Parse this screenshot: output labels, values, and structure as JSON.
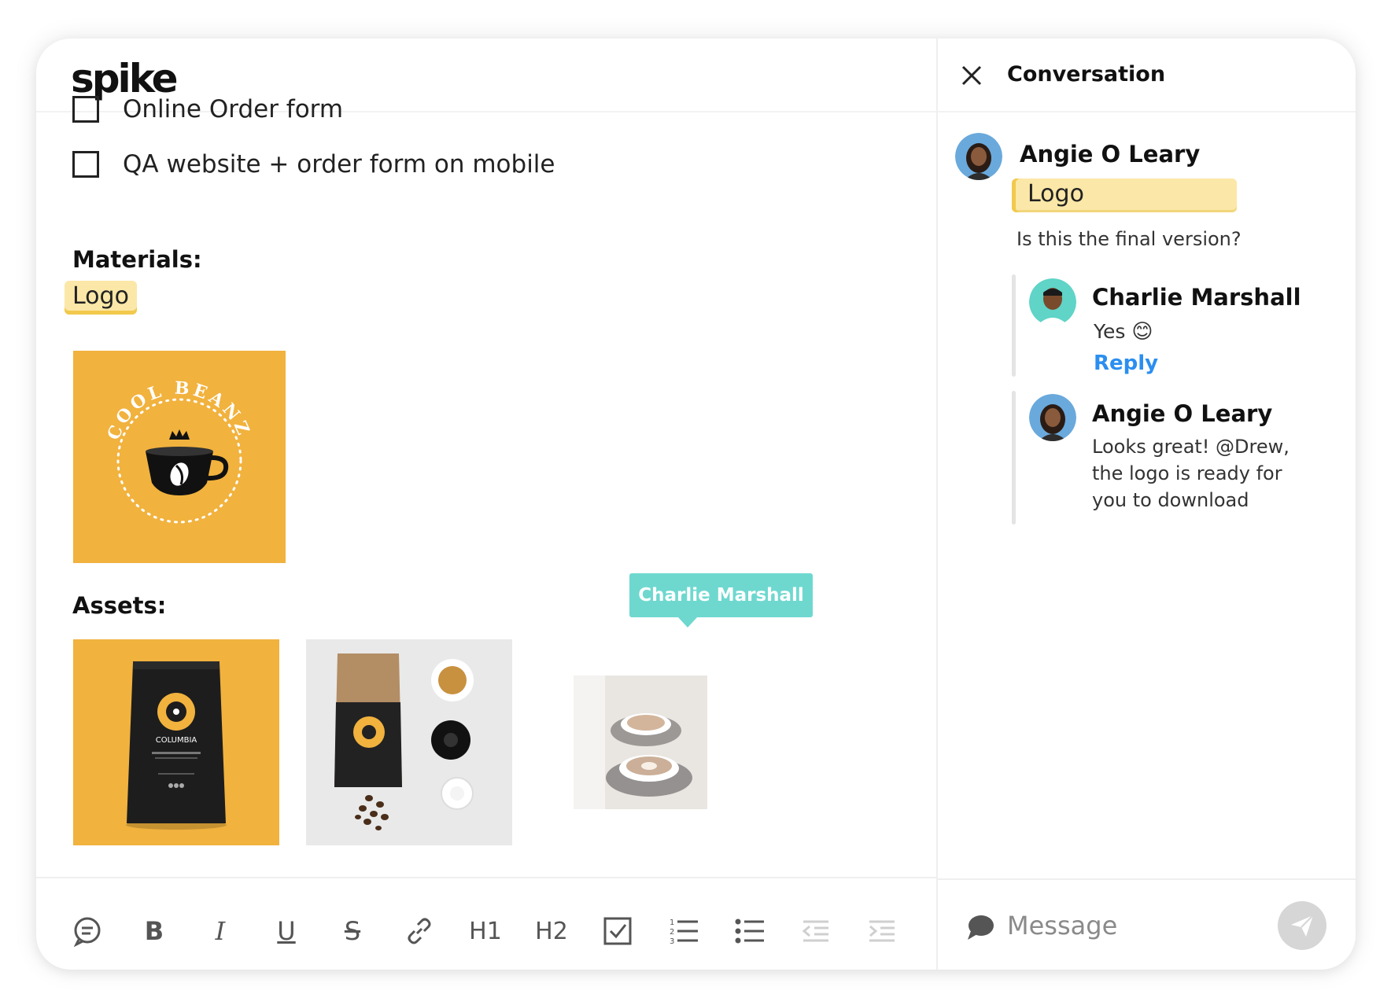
{
  "app": {
    "logo_text": "spike"
  },
  "editor": {
    "tasks": [
      {
        "label": "Online Order form",
        "checked": false
      },
      {
        "label": "QA website + order form on mobile",
        "checked": false
      }
    ],
    "materials_heading": "Materials:",
    "materials_tag": "Logo",
    "logo_image": {
      "ring_text": "COOL BEANZ",
      "icon": "coffee-cup-with-crown",
      "bg_color": "#f1b23e"
    },
    "assets_heading": "Assets:",
    "assets": [
      {
        "name": "coffee-bag-photo",
        "label_text": "COLUMBIA"
      },
      {
        "name": "coffee-flatlay-photo"
      },
      {
        "name": "latte-cups-photo"
      }
    ],
    "cursor_tooltip": "Charlie Marshall"
  },
  "toolbar": {
    "items": [
      {
        "name": "comment-icon"
      },
      {
        "name": "bold-icon",
        "glyph": "B"
      },
      {
        "name": "italic-icon",
        "glyph": "I"
      },
      {
        "name": "underline-icon",
        "glyph": "U"
      },
      {
        "name": "strikethrough-icon",
        "glyph": "S"
      },
      {
        "name": "link-icon"
      },
      {
        "name": "heading1-icon",
        "glyph": "H1"
      },
      {
        "name": "heading2-icon",
        "glyph": "H2"
      },
      {
        "name": "checkbox-icon"
      },
      {
        "name": "ordered-list-icon"
      },
      {
        "name": "bullet-list-icon"
      },
      {
        "name": "outdent-icon"
      },
      {
        "name": "indent-icon"
      }
    ]
  },
  "conversation": {
    "title": "Conversation",
    "root": {
      "author": "Angie O Leary",
      "quote": "Logo",
      "text": "Is this the final version?"
    },
    "replies": [
      {
        "author": "Charlie Marshall",
        "text": "Yes",
        "emoji": "😊",
        "reply_label": "Reply"
      },
      {
        "author": "Angie O Leary",
        "text": "Looks great! @Drew, the logo is ready for you to download"
      }
    ],
    "compose": {
      "placeholder": "Message"
    }
  },
  "colors": {
    "accent_yellow": "#f1b23e",
    "tag_bg": "#fbe7a7",
    "tooltip_teal": "#6ed8cf",
    "link_blue": "#2b8ef0"
  }
}
